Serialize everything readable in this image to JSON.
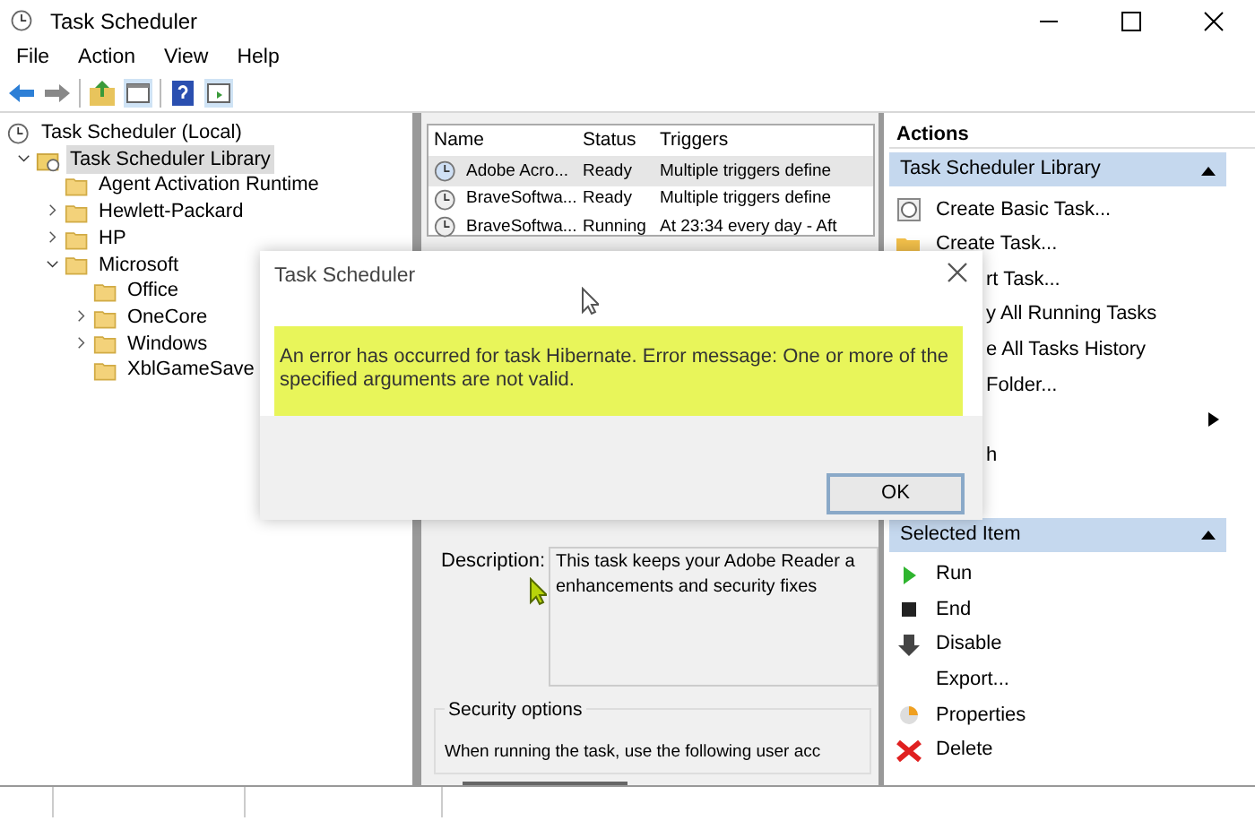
{
  "window": {
    "title": "Task Scheduler"
  },
  "menu": [
    {
      "label": "File"
    },
    {
      "label": "Action"
    },
    {
      "label": "View"
    },
    {
      "label": "Help"
    }
  ],
  "tree": [
    {
      "label": "Task Scheduler (Local)",
      "kind": "clock",
      "selected": false,
      "children": [
        {
          "label": "Task Scheduler Library",
          "kind": "library",
          "selected": true,
          "expanded": true,
          "children": [
            {
              "label": "Agent Activation Runtime",
              "kind": "folder",
              "selected": false
            },
            {
              "label": "Hewlett-Packard",
              "kind": "folder",
              "selected": false,
              "expanded": false
            },
            {
              "label": "HP",
              "kind": "folder",
              "selected": false,
              "expanded": false
            },
            {
              "label": "Microsoft",
              "kind": "folder",
              "selected": false,
              "expanded": true,
              "children": [
                {
                  "label": "Office",
                  "kind": "folder",
                  "selected": false
                },
                {
                  "label": "OneCore",
                  "kind": "folder",
                  "selected": false,
                  "expanded": false
                },
                {
                  "label": "Windows",
                  "kind": "folder",
                  "selected": false,
                  "expanded": false
                },
                {
                  "label": "XblGameSave",
                  "kind": "folder",
                  "selected": false
                }
              ]
            }
          ]
        }
      ]
    }
  ],
  "tasks": {
    "columns": [
      "Name",
      "Status",
      "Triggers"
    ],
    "rows": [
      {
        "name": "Adobe Acro...",
        "status": "Ready",
        "triggers": "Multiple triggers define",
        "selected": true
      },
      {
        "name": "BraveSoftwa...",
        "status": "Ready",
        "triggers": "Multiple triggers define",
        "selected": false
      },
      {
        "name": "BraveSoftwa...",
        "status": "Running",
        "triggers": "At 23:34 every day - Aft",
        "selected": false
      }
    ]
  },
  "details": {
    "description_label": "Description:",
    "description_lines": [
      "This task keeps your Adobe Reader a",
      "enhancements and security fixes"
    ],
    "security_title": "Security options",
    "security_text": "When running the task, use the following user acc"
  },
  "actions": {
    "title": "Actions",
    "sections": [
      {
        "title": "Task Scheduler Library",
        "expanded": true,
        "items": [
          {
            "label": "Create Basic Task...",
            "kind": "basic-task",
            "covered": false
          },
          {
            "label": "Create Task...",
            "kind": "create-task",
            "covered": false
          },
          {
            "label": "rt Task...",
            "covered": true
          },
          {
            "label": "y All Running Tasks",
            "covered": true
          },
          {
            "label": "e All Tasks History",
            "covered": true
          },
          {
            "label": "Folder...",
            "covered": true
          },
          {
            "submenu": true,
            "covered": true
          },
          {
            "label": "h",
            "covered": true
          }
        ]
      },
      {
        "title": "Selected Item",
        "expanded": true,
        "items": [
          {
            "label": "Run",
            "kind": "run",
            "covered": false
          },
          {
            "label": "End",
            "kind": "end",
            "covered": false
          },
          {
            "label": "Disable",
            "kind": "disable",
            "covered": false
          },
          {
            "label": "Export...",
            "covered": false
          },
          {
            "label": "Properties",
            "kind": "properties",
            "covered": false
          },
          {
            "label": "Delete",
            "kind": "delete",
            "covered": false
          }
        ]
      }
    ]
  },
  "dialog": {
    "title": "Task Scheduler",
    "message": "An error has occurred for task Hibernate. Error message: One or more of the specified arguments are not valid.",
    "button": "OK"
  }
}
